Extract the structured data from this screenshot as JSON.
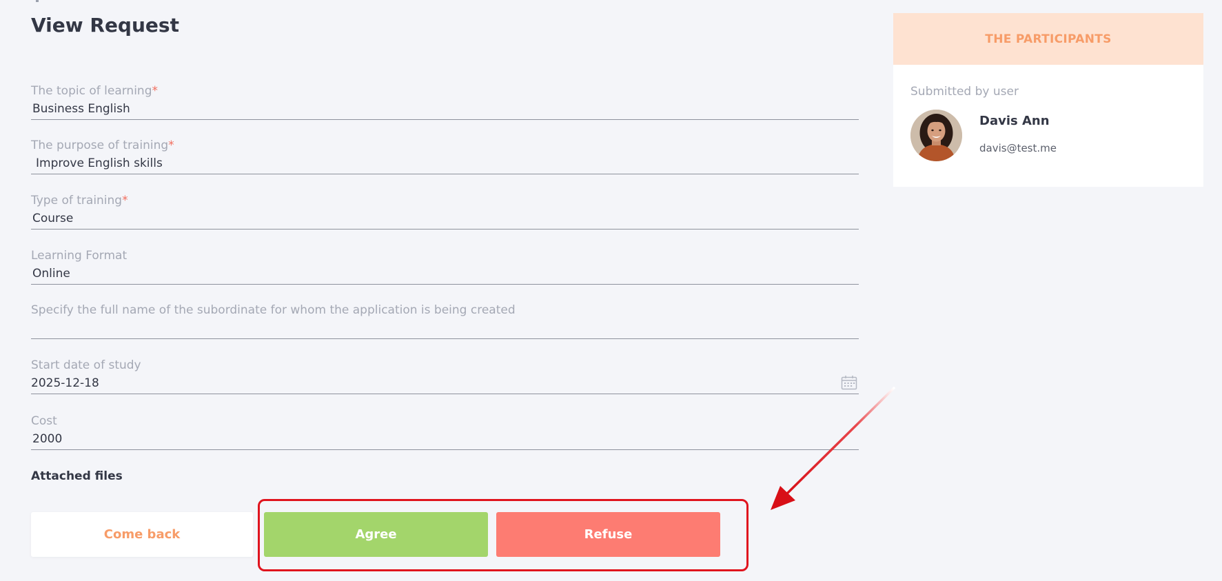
{
  "page": {
    "title": "View Request"
  },
  "fields": {
    "topic": {
      "label": "The topic of learning",
      "required_mark": "*",
      "value": "Business English"
    },
    "purpose": {
      "label": "The purpose of training",
      "required_mark": "*",
      "value": "Improve English skills"
    },
    "type": {
      "label": "Type of training",
      "required_mark": "*",
      "value": "Course"
    },
    "format": {
      "label": "Learning Format",
      "value": "Online"
    },
    "subordinate": {
      "label": "Specify the full name of the subordinate for whom the application is being created",
      "value": ""
    },
    "start_date": {
      "label": "Start date of study",
      "value": "2025-12-18",
      "icon": "calendar-icon"
    },
    "cost": {
      "label": "Cost",
      "value": "2000"
    }
  },
  "attached_files": {
    "label": "Attached files"
  },
  "actions": {
    "back_label": "Come back",
    "agree_label": "Agree",
    "refuse_label": "Refuse"
  },
  "participants": {
    "header": "THE PARTICIPANTS",
    "submitted_label": "Submitted by user",
    "user": {
      "name": "Davis Ann",
      "email": "davis@test.me",
      "avatar": "avatar-photo"
    }
  },
  "colors": {
    "accent": "#f79c68",
    "agree": "#a3d56b",
    "refuse": "#fd7c72",
    "participants_header_bg": "#fee2d1",
    "annotation": "#e0141e",
    "required": "#f26e5e"
  }
}
